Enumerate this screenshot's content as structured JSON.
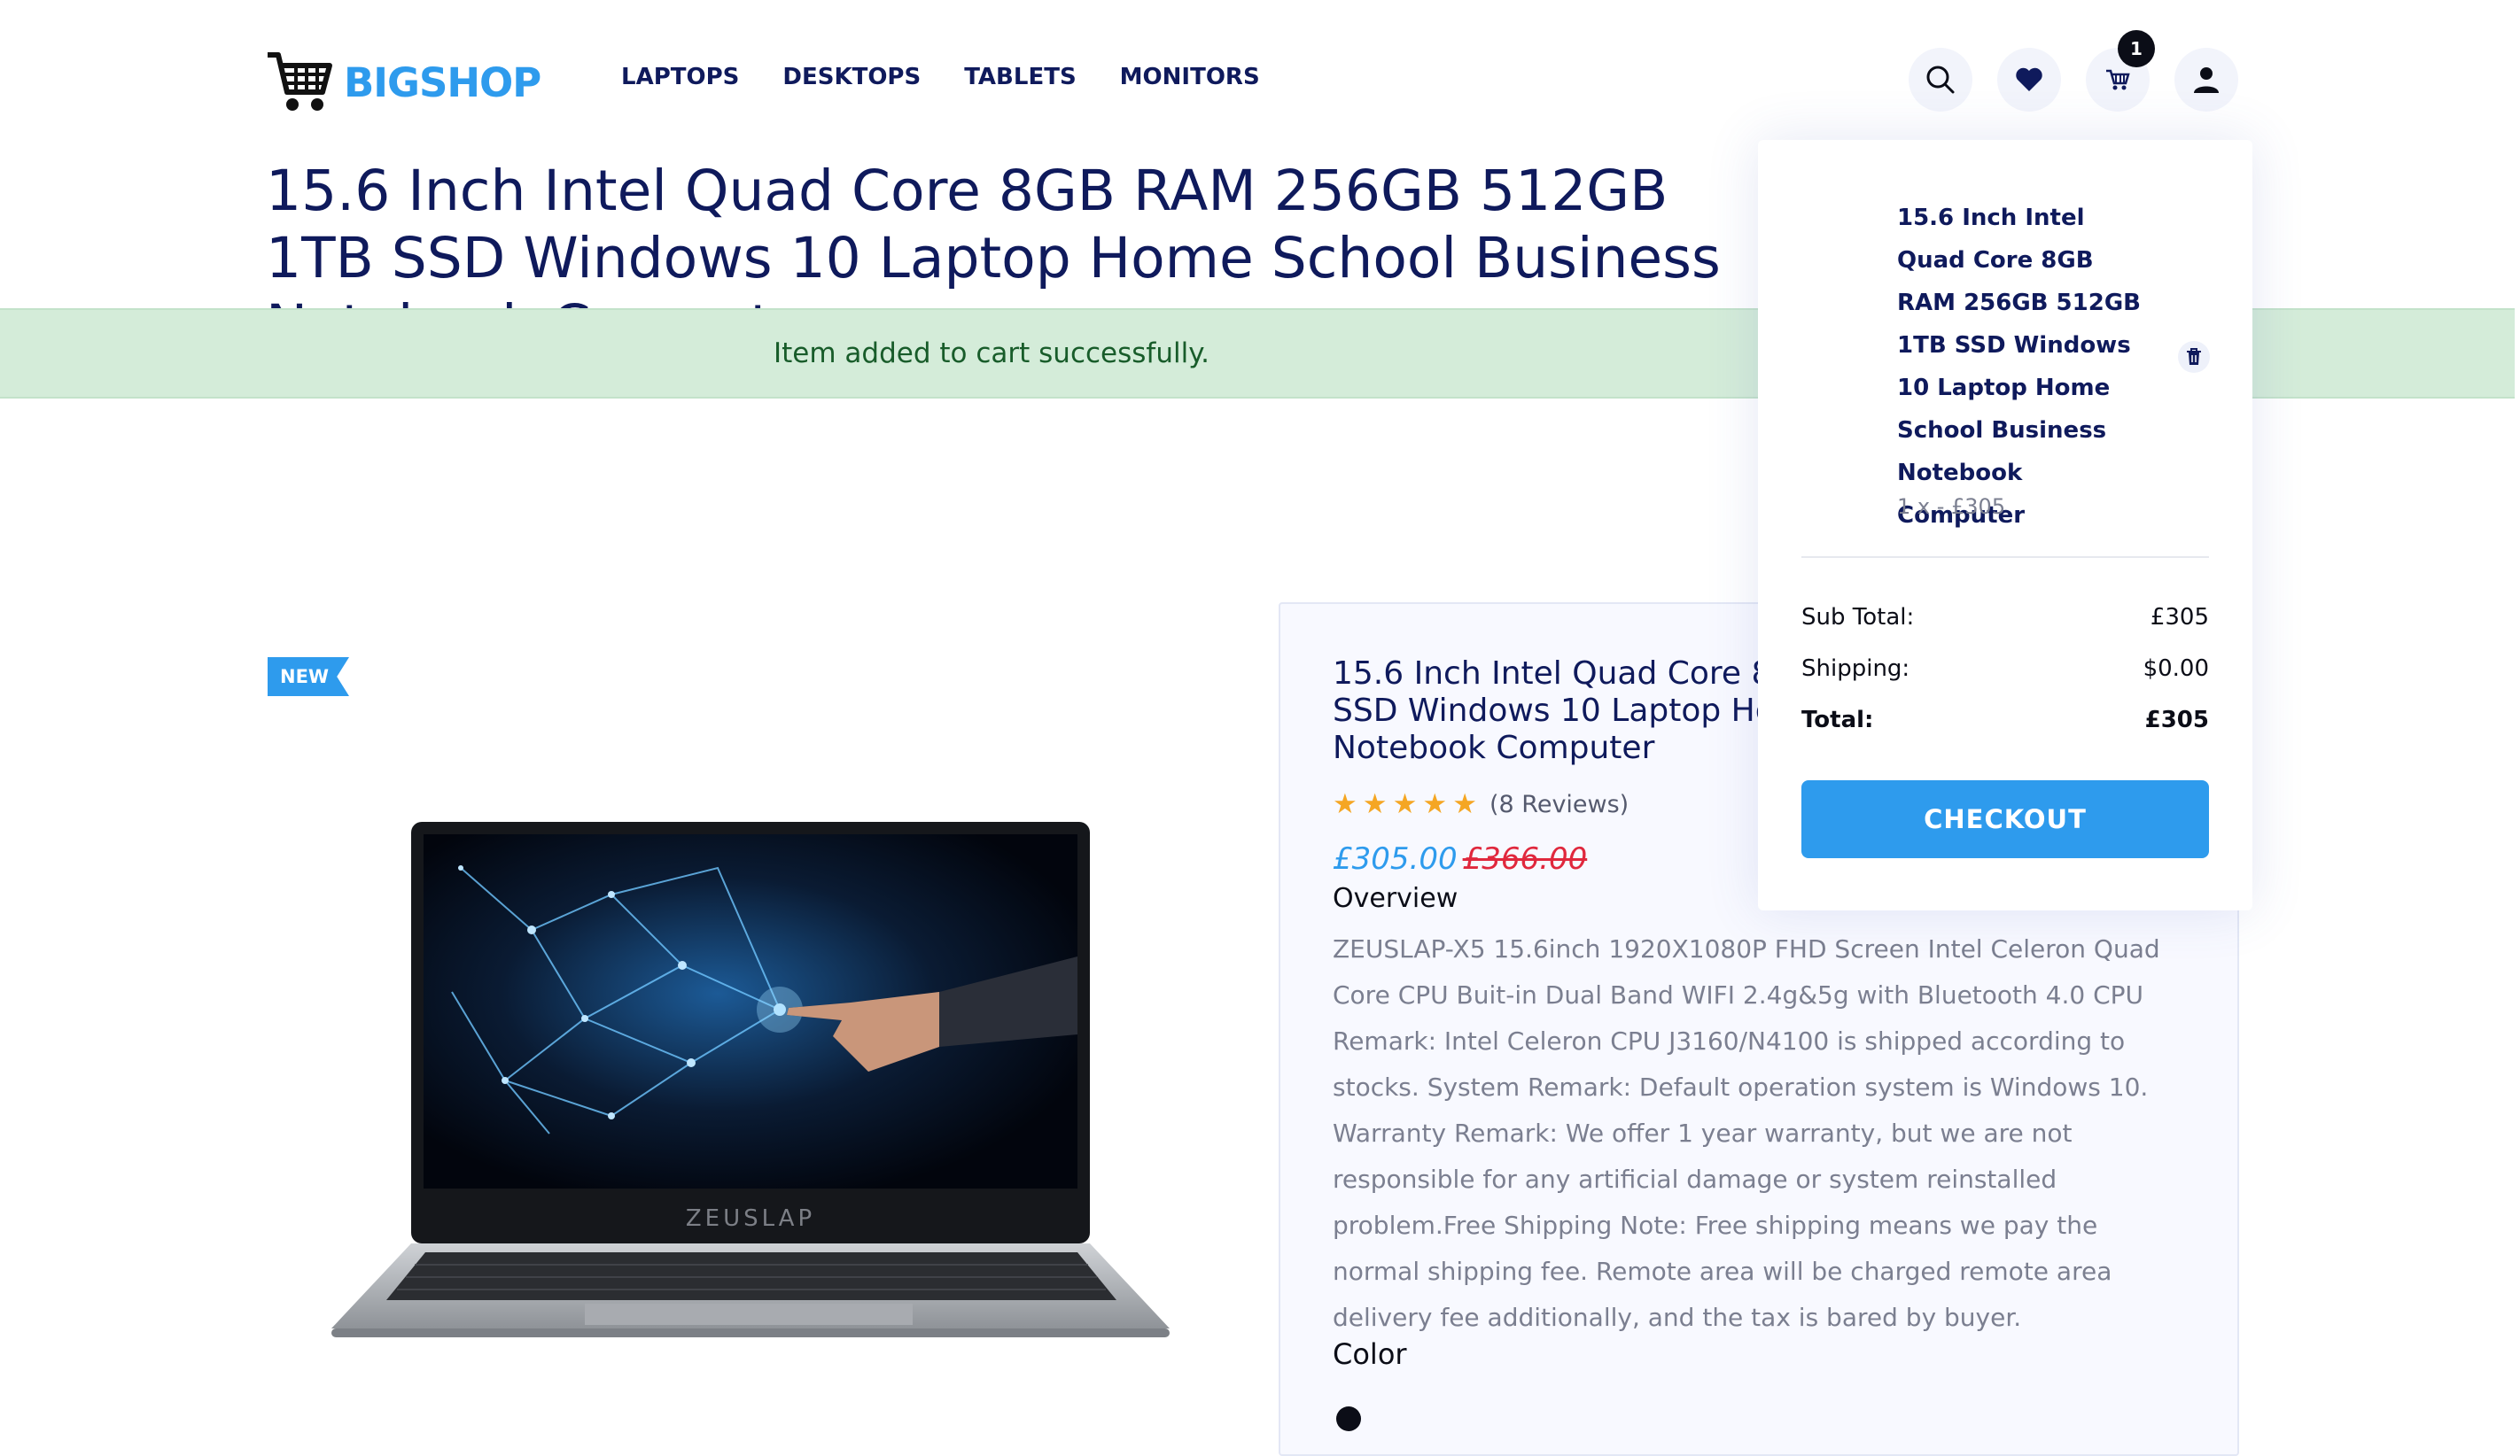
{
  "header": {
    "brand": "BIGSHOP",
    "nav": [
      "LAPTOPS",
      "DESKTOPS",
      "TABLETS",
      "MONITORS"
    ],
    "cart_count": "1",
    "icons": [
      "search-icon",
      "heart-icon",
      "cart-icon",
      "user-icon"
    ]
  },
  "page": {
    "title": "15.6 Inch Intel Quad Core 8GB RAM 256GB 512GB 1TB SSD Windows 10 Laptop Home School Business Notebook Computer"
  },
  "alert": {
    "message": "Item added to cart successfully."
  },
  "product": {
    "badge": "NEW",
    "laptop_brand": "ZEUSLAP",
    "title": "15.6 Inch Intel Quad Core 8GB RAM 256GB 512GB 1TB SSD Windows 10 Laptop Home School Business Notebook Computer",
    "rating": 5,
    "reviews": "(8 Reviews)",
    "price": "£305.00",
    "old_price": "£366.00",
    "overview_heading": "Overview",
    "description": "ZEUSLAP-X5 15.6inch 1920X1080P FHD Screen Intel Celeron Quad Core CPU Buit-in Dual Band WIFI 2.4g&5g with Bluetooth 4.0 CPU Remark: Intel Celeron CPU J3160/N4100 is shipped according to stocks. System Remark: Default operation system is Windows 10. Warranty Remark: We offer 1 year warranty, but we are not responsible for any artificial damage or system reinstalled problem.Free Shipping Note: Free shipping means we pay the normal shipping fee. Remote area will be charged remote area delivery fee additionally, and the tax is bared by buyer.",
    "color_heading": "Color"
  },
  "cart_dropdown": {
    "item_title": "15.6 Inch Intel Quad Core 8GB RAM 256GB 512GB 1TB SSD Windows 10 Laptop Home School Business Notebook Computer",
    "item_qty": "1 x - £305",
    "subtotal_label": "Sub Total:",
    "subtotal_value": "£305",
    "shipping_label": "Shipping:",
    "shipping_value": "$0.00",
    "total_label": "Total:",
    "total_value": "£305",
    "checkout_label": "CHECKOUT"
  },
  "colors": {
    "accent": "#2e9bed",
    "navy": "#0f1a5c",
    "alert_bg": "#d4ecd9",
    "sale_red": "#e0283d",
    "star": "#f5a623"
  }
}
